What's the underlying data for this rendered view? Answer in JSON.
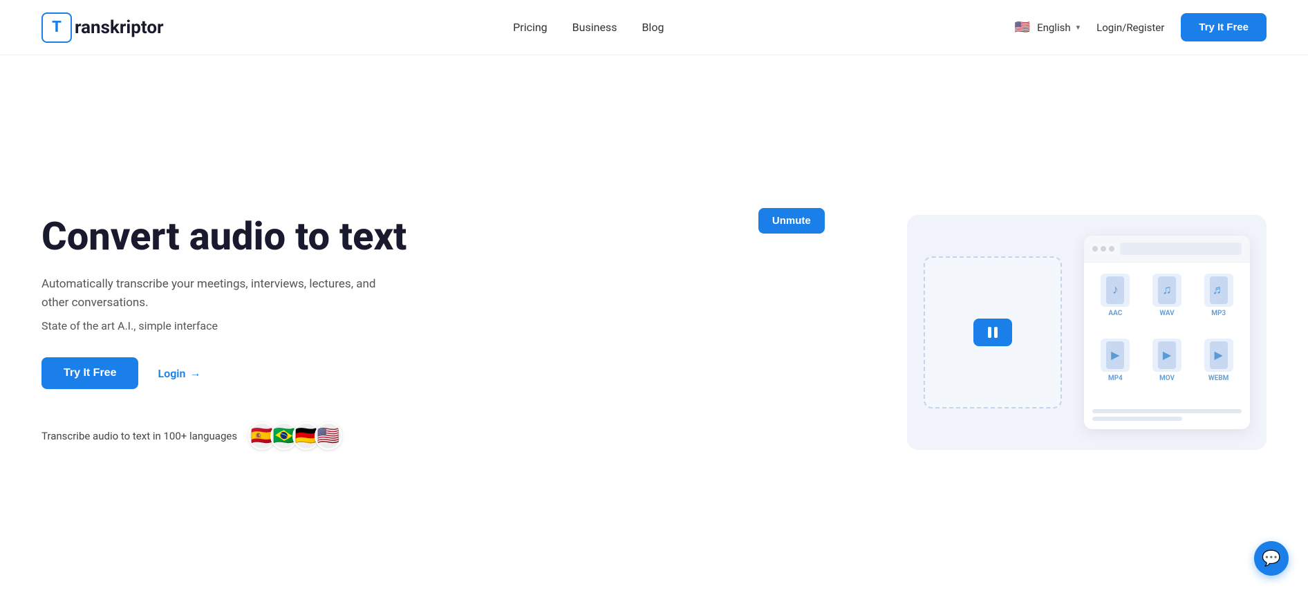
{
  "navbar": {
    "logo_letter": "T",
    "logo_text": "ranskriptor",
    "nav_links": [
      {
        "label": "Pricing",
        "id": "pricing"
      },
      {
        "label": "Business",
        "id": "business"
      },
      {
        "label": "Blog",
        "id": "blog"
      }
    ],
    "language": {
      "flag": "🇺🇸",
      "label": "English"
    },
    "login_label": "Login/Register",
    "cta_label": "Try It Free"
  },
  "hero": {
    "title": "Convert audio to text",
    "description": "Automatically transcribe your meetings, interviews, lectures, and other conversations.",
    "state_of_art": "State of the art A.I., simple interface",
    "cta_primary": "Try It Free",
    "cta_login": "Login",
    "login_arrow": "→",
    "languages_text": "Transcribe audio to text in 100+ languages",
    "flags": [
      "🇪🇸",
      "🇧🇷",
      "🇩🇪",
      "🇺🇸"
    ],
    "unmute_label": "Unmute"
  },
  "file_formats": [
    {
      "label": "AAC",
      "type": "audio"
    },
    {
      "label": "WAV",
      "type": "audio"
    },
    {
      "label": "MP3",
      "type": "audio"
    },
    {
      "label": "MP4",
      "type": "video"
    },
    {
      "label": "MOV",
      "type": "video"
    },
    {
      "label": "WEBM",
      "type": "video"
    }
  ],
  "colors": {
    "primary": "#1a7fe8",
    "text_dark": "#1a1a2e",
    "text_mid": "#555555",
    "bg_light": "#f0f4fa"
  }
}
